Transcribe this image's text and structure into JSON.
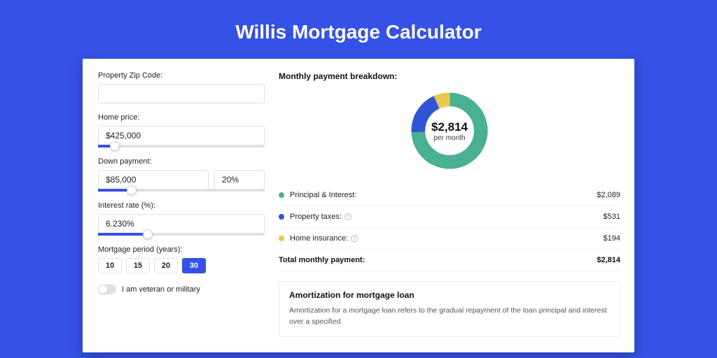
{
  "page_title": "Willis Mortgage Calculator",
  "colors": {
    "principal": "#49b093",
    "taxes": "#2f55d4",
    "insurance": "#e7c94c"
  },
  "zip": {
    "label": "Property Zip Code:",
    "value": ""
  },
  "home_price": {
    "label": "Home price:",
    "value": "$425,000",
    "slider_pct": 10
  },
  "down_payment": {
    "label": "Down payment:",
    "amount": "$85,000",
    "percent": "20%",
    "slider_pct": 20
  },
  "interest_rate": {
    "label": "Interest rate (%):",
    "value": "6.230%",
    "slider_pct": 30
  },
  "period": {
    "label": "Mortgage period (years):",
    "options": [
      "10",
      "15",
      "20",
      "30"
    ],
    "active": "30"
  },
  "veteran": {
    "label": "I am veteran or military",
    "on": false
  },
  "breakdown": {
    "title": "Monthly payment breakdown:",
    "center_value": "$2,814",
    "center_sub": "per month",
    "items": [
      {
        "label": "Principal & Interest:",
        "value": "$2,089",
        "color": "#49b093",
        "info": false
      },
      {
        "label": "Property taxes:",
        "value": "$531",
        "color": "#2f55d4",
        "info": true
      },
      {
        "label": "Home insurance:",
        "value": "$194",
        "color": "#e7c94c",
        "info": true
      }
    ],
    "total_label": "Total monthly payment:",
    "total_value": "$2,814"
  },
  "amort": {
    "title": "Amortization for mortgage loan",
    "text": "Amortization for a mortgage loan refers to the gradual repayment of the loan principal and interest over a specified"
  },
  "chart_data": {
    "type": "pie",
    "title": "Monthly payment breakdown",
    "series": [
      {
        "name": "Principal & Interest",
        "value": 2089
      },
      {
        "name": "Property taxes",
        "value": 531
      },
      {
        "name": "Home insurance",
        "value": 194
      }
    ],
    "total": 2814
  }
}
